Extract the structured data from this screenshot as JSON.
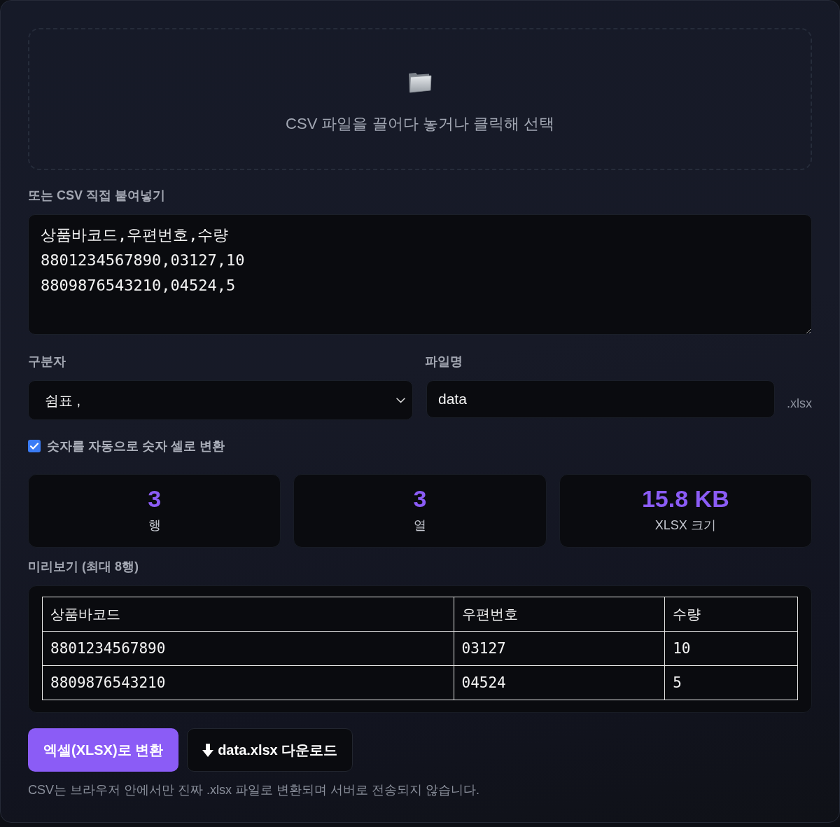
{
  "dropzone": {
    "text": "CSV 파일을 끌어다 놓거나 클릭해 선택"
  },
  "paste": {
    "label": "또는 CSV 직접 붙여넣기",
    "value": "상품바코드,우편번호,수량\n8801234567890,03127,10\n8809876543210,04524,5"
  },
  "delimiter": {
    "label": "구분자",
    "value": "쉼표 ,"
  },
  "filename": {
    "label": "파일명",
    "value": "data",
    "suffix": ".xlsx"
  },
  "auto_numbers": {
    "label": "숫자를 자동으로 숫자 셀로 변환",
    "checked": true
  },
  "stats": [
    {
      "value": "3",
      "label": "행"
    },
    {
      "value": "3",
      "label": "열"
    },
    {
      "value": "15.8 KB",
      "label": "XLSX 크기"
    }
  ],
  "preview": {
    "title": "미리보기 (최대 8행)",
    "columns": [
      "상품바코드",
      "우편번호",
      "수량"
    ],
    "rows": [
      [
        "8801234567890",
        "03127",
        "10"
      ],
      [
        "8809876543210",
        "04524",
        "5"
      ]
    ]
  },
  "buttons": [
    {
      "kind": "primary",
      "label": "엑셀(XLSX)로 변환"
    },
    {
      "kind": "download",
      "label": "data.xlsx 다운로드"
    }
  ],
  "note": "CSV는 브라우저 안에서만 진짜 .xlsx 파일로 변환되며 서버로 전송되지 않습니다."
}
